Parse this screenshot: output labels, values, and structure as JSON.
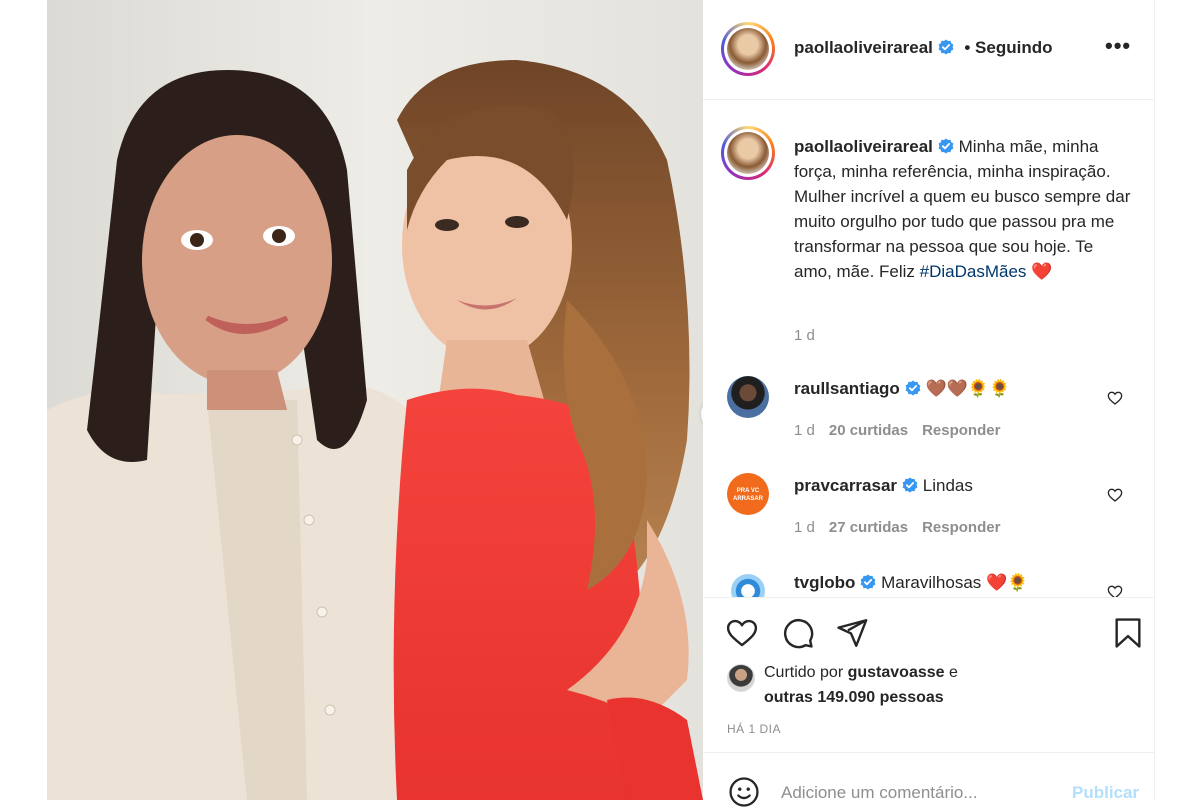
{
  "post": {
    "username": "paollaoliveirareal",
    "following_label": "• Seguindo",
    "more_label": "•••",
    "caption": "Minha mãe, minha força, minha referência, minha inspiração. Mulher incrível a quem eu busco sempre dar muito orgulho por tudo que passou pra me transformar na pessoa que sou hoje. Te amo, mãe. Feliz",
    "hashtag": "#DiaDasMães",
    "caption_emoji": "❤️",
    "caption_time": "1 d"
  },
  "comments": [
    {
      "username": "raullsantiago",
      "text": "🤎🤎🌻🌻",
      "time": "1 d",
      "likes": "20 curtidas",
      "reply": "Responder"
    },
    {
      "username": "pravcarrasar",
      "text": "Lindas",
      "time": "1 d",
      "likes": "27 curtidas",
      "reply": "Responder",
      "avatar_label": "PRA VC ARRASAR"
    },
    {
      "username": "tvglobo",
      "text": "Maravilhosas ❤️🌻"
    }
  ],
  "likes": {
    "prefix": "Curtido por",
    "user": "gustavoasse",
    "connector": "e",
    "others": "outras 149.090 pessoas"
  },
  "post_date": "HÁ 1 DIA",
  "comment_box": {
    "placeholder": "Adicione um comentário...",
    "publish_label": "Publicar"
  },
  "colors": {
    "verified": "#3897f0",
    "hashtag": "#00376b",
    "publish_disabled": "#b2dffc",
    "muted": "#8e8e8e",
    "orange_avatar": "#f26b1d"
  },
  "icons": [
    "next-arrow-icon",
    "verified-badge-icon",
    "heart-icon",
    "comment-icon",
    "share-icon",
    "bookmark-icon",
    "emoji-icon"
  ]
}
